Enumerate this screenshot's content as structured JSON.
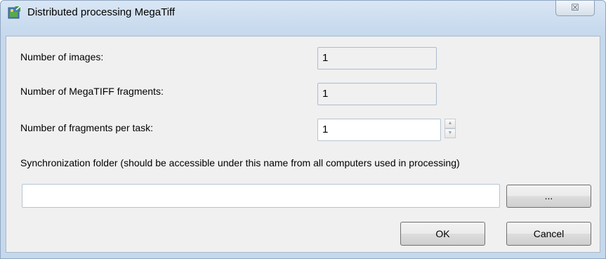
{
  "window": {
    "title": "Distributed processing MegaTiff",
    "icon": "app-icon",
    "close_glyph": "☒"
  },
  "form": {
    "images_label": "Number of images:",
    "images_value": "1",
    "fragments_label": "Number of MegaTIFF fragments:",
    "fragments_value": "1",
    "per_task_label": "Number of fragments per task:",
    "per_task_value": "1",
    "sync_label": "Synchronization folder (should be accessible under this name from all computers used in processing)",
    "sync_value": "",
    "browse_label": "...",
    "spin_up": "▲",
    "spin_down": "▼"
  },
  "buttons": {
    "ok_label": "OK",
    "cancel_label": "Cancel"
  }
}
